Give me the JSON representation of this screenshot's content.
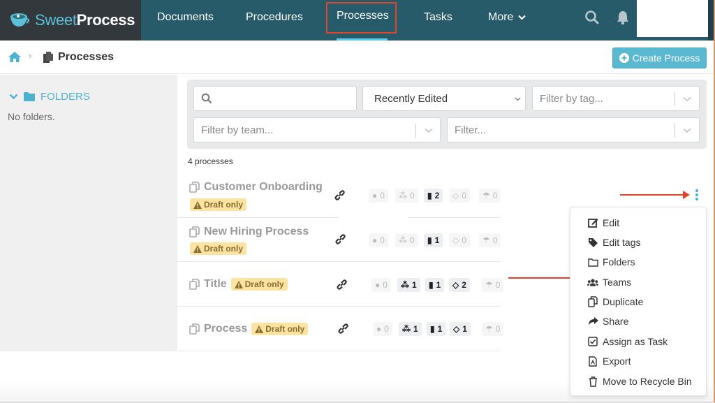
{
  "brand": {
    "sweet": "Sweet",
    "process": "Process"
  },
  "nav": {
    "items": [
      {
        "label": "Documents"
      },
      {
        "label": "Procedures"
      },
      {
        "label": "Processes",
        "active": true
      },
      {
        "label": "Tasks"
      },
      {
        "label": "More"
      }
    ],
    "search_icon": "search-icon",
    "bell_icon": "bell-icon"
  },
  "breadcrumb": {
    "home_icon": "home-icon",
    "separator": "›",
    "title": "Processes"
  },
  "create_button": {
    "label": "Create Process"
  },
  "sidebar": {
    "folders_label": "FOLDERS",
    "empty_text": "No folders."
  },
  "filters": {
    "search_placeholder": "",
    "sort_value": "Recently Edited",
    "tag_placeholder": "Filter by tag...",
    "team_placeholder": "Filter by team...",
    "generic_placeholder": "Filter..."
  },
  "count_label": "4 processes",
  "processes": [
    {
      "title": "Customer Onboarding",
      "badge": "Draft only",
      "stats": {
        "tags": "0",
        "teams": "0",
        "docs": "2",
        "steps": "0",
        "approvals": "0"
      }
    },
    {
      "title": "New Hiring Process",
      "badge": "Draft only",
      "stats": {
        "tags": "0",
        "teams": "0",
        "docs": "1",
        "steps": "0",
        "approvals": "0"
      }
    },
    {
      "title": "Title",
      "badge": "Draft only",
      "stats": {
        "tags": "0",
        "teams": "1",
        "docs": "1",
        "steps": "2",
        "approvals": "0"
      }
    },
    {
      "title": "Process",
      "badge": "Draft only",
      "stats": {
        "tags": "0",
        "teams": "1",
        "docs": "1",
        "steps": "1",
        "approvals": "0"
      }
    }
  ],
  "menu": {
    "items": [
      {
        "label": "Edit",
        "icon": "edit-icon"
      },
      {
        "label": "Edit tags",
        "icon": "tag-icon"
      },
      {
        "label": "Folders",
        "icon": "folder-icon"
      },
      {
        "label": "Teams",
        "icon": "users-icon"
      },
      {
        "label": "Duplicate",
        "icon": "copy-icon"
      },
      {
        "label": "Share",
        "icon": "share-icon"
      },
      {
        "label": "Assign as Task",
        "icon": "checkbox-icon"
      },
      {
        "label": "Export",
        "icon": "pdf-icon"
      },
      {
        "label": "Move to Recycle Bin",
        "icon": "trash-icon"
      }
    ]
  },
  "colors": {
    "nav_bg": "#275b69",
    "logo_bg": "#33383d",
    "accent": "#5ab8d1",
    "annotation": "#e0442b",
    "badge_bg": "#fbe3a3"
  }
}
